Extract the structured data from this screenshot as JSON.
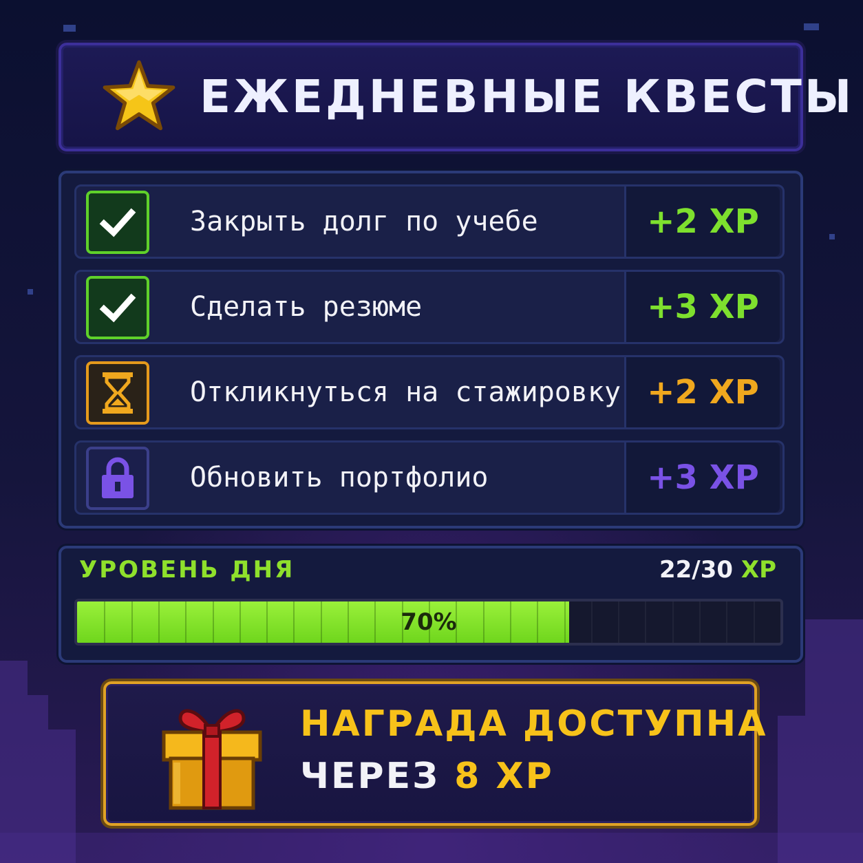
{
  "header": {
    "title": "ЕЖЕДНЕВНЫЕ КВЕСТЫ",
    "icon": "star-icon"
  },
  "quests": [
    {
      "label": "Закрыть долг по учебе",
      "reward": "+2 XP",
      "status": "done",
      "icon": "checkmark-icon",
      "color": "#7ee02e"
    },
    {
      "label": "Сделать резюме",
      "reward": "+3 XP",
      "status": "done",
      "icon": "checkmark-icon",
      "color": "#7ee02e"
    },
    {
      "label": "Откликнуться на стажировку",
      "reward": "+2 XP",
      "status": "in-progress",
      "icon": "hourglass-icon",
      "color": "#f0a81e"
    },
    {
      "label": "Обновить портфолио",
      "reward": "+3 XP",
      "status": "locked",
      "icon": "lock-icon",
      "color": "#7a52e6"
    }
  ],
  "level": {
    "title": "УРОВЕНЬ ДНЯ",
    "current": "22/30",
    "unit": "XP",
    "progress_label": "70%",
    "progress_fraction": 0.7
  },
  "reward": {
    "line1": "НАГРАДА ДОСТУПНА",
    "line2_prefix": "ЧЕРЕЗ",
    "line2_amount": "8 XP",
    "icon": "gift-icon"
  },
  "colors": {
    "accent_green": "#8fe02c",
    "accent_gold": "#f7c21a",
    "accent_purple": "#7a52e6",
    "panel_bg": "#141a3e"
  }
}
